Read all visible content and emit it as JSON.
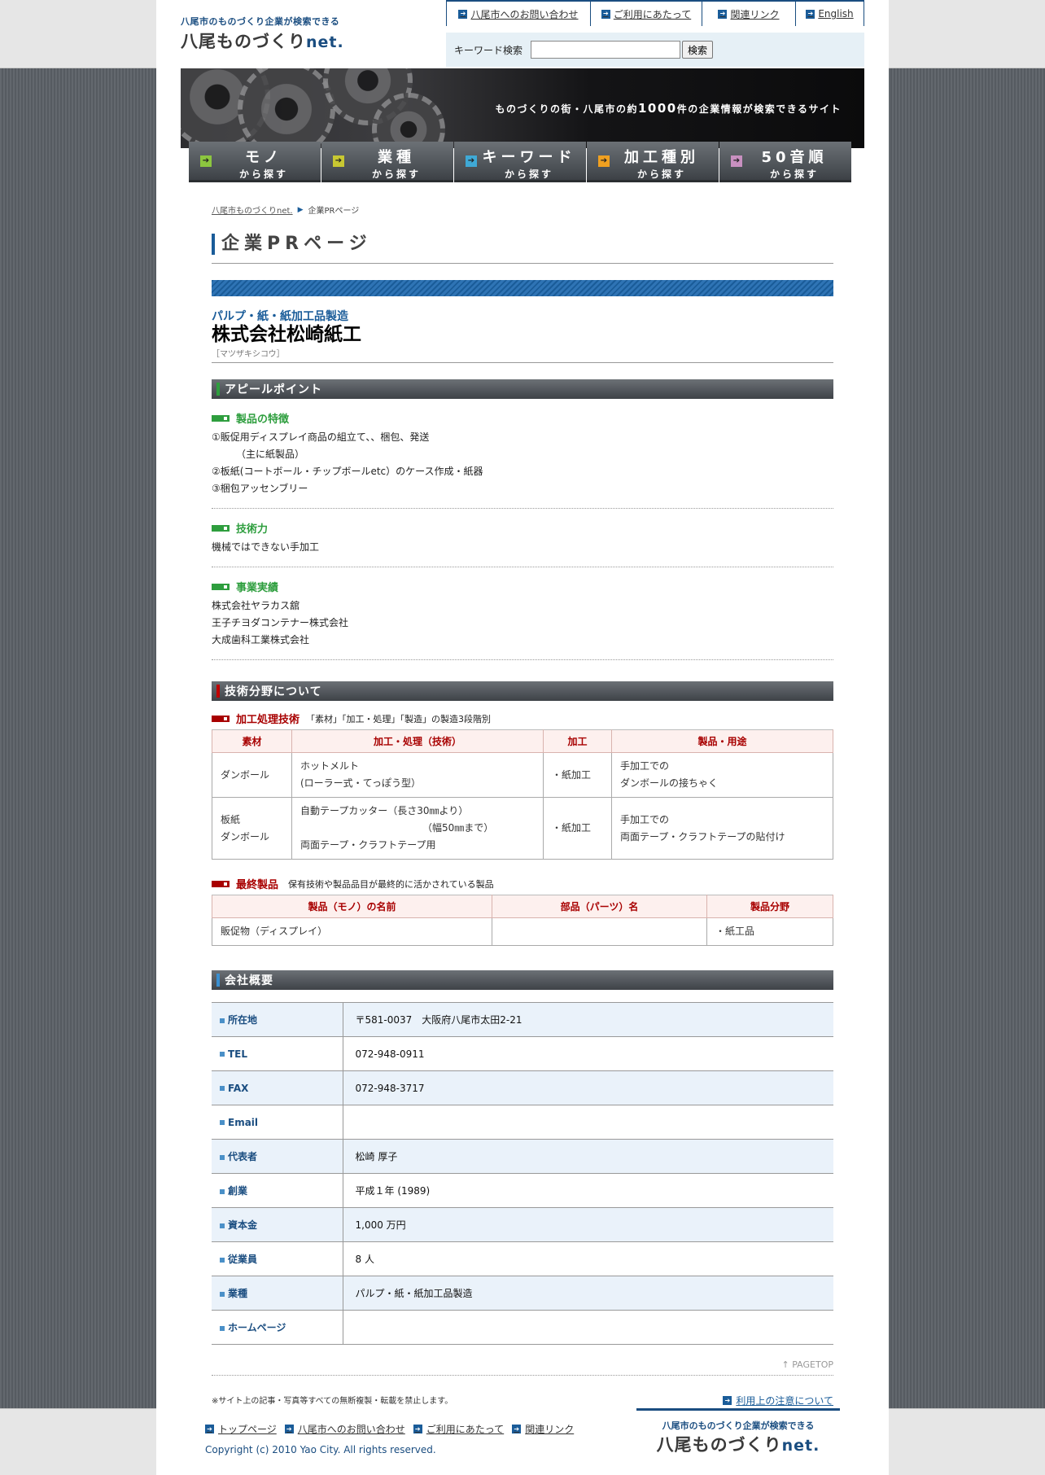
{
  "header": {
    "logo_tagline": "八尾市のものづくり企業が検索できる",
    "logo_name": "八尾ものづくり",
    "logo_suffix": "net.",
    "top_links": [
      "八尾市へのお問い合わせ",
      "ご利用にあたって",
      "関連リンク",
      "English"
    ],
    "search_label": "キーワード検索",
    "search_value": "",
    "search_button": "検索"
  },
  "banner": {
    "slogan_pre": "ものづくりの街・八尾市の約",
    "slogan_num": "1000",
    "slogan_post": "件の企業情報が検索できるサイト"
  },
  "nav": [
    {
      "big": "モノ",
      "small": "から探す",
      "icon_color": "#8cc63f"
    },
    {
      "big": "業種",
      "small": "から探す",
      "icon_color": "#c8c832"
    },
    {
      "big": "キーワード",
      "small": "から探す",
      "icon_color": "#3fa9d6"
    },
    {
      "big": "加工種別",
      "small": "から探す",
      "icon_color": "#f0a020"
    },
    {
      "big": "50音順",
      "small": "から探す",
      "icon_color": "#c890c0"
    }
  ],
  "breadcrumb": {
    "home": "八尾市ものづくりnet.",
    "current": "企業PRページ"
  },
  "page_title": "企業PRページ",
  "company": {
    "category": "パルプ・紙・紙加工品製造",
    "name": "株式会社松崎紙工",
    "kana": "［マツザキシコウ］"
  },
  "appeal": {
    "heading": "アピールポイント",
    "features": {
      "title": "製品の特徴",
      "lines": [
        "①販促用ディスプレイ商品の組立て、、梱包、発送",
        "（主に紙製品）",
        "②板紙(コートボール・チップボールetc）のケース作成・紙器",
        "③梱包アッセンブリー"
      ]
    },
    "tech": {
      "title": "技術力",
      "lines": [
        "機械ではできない手加工"
      ]
    },
    "record": {
      "title": "事業実績",
      "lines": [
        "株式会社ヤラカス舘",
        "王子チヨダコンテナー株式会社",
        "大成歯科工業株式会社"
      ]
    }
  },
  "tech_field": {
    "heading": "技術分野について",
    "processing": {
      "title": "加工処理技術",
      "note": "「素材」「加工・処理」「製造」の製造3段階別",
      "headers": [
        "素材",
        "加工・処理（技術）",
        "加工",
        "製品・用途"
      ],
      "rows": [
        {
          "material": [
            "ダンボール"
          ],
          "process": [
            "ホットメルト",
            "(ローラー式・てっぽう型）"
          ],
          "kako": "・紙加工",
          "use": [
            "手加工での",
            "ダンボールの接ちゃく"
          ]
        },
        {
          "material": [
            "板紙",
            "ダンボール"
          ],
          "process": [
            "自動テープカッター（長さ30㎜より）",
            "（幅50㎜まで）",
            "両面テープ・クラフトテープ用"
          ],
          "kako": "・紙加工",
          "use": [
            "手加工での",
            "両面テープ・クラフトテープの貼付け"
          ]
        }
      ]
    },
    "final": {
      "title": "最終製品",
      "note": "保有技術や製品品目が最終的に活かされている製品",
      "headers": [
        "製品（モノ）の名前",
        "部品（パーツ）名",
        "製品分野"
      ],
      "row": [
        "販促物（ディスプレイ）",
        "",
        "・紙工品"
      ]
    }
  },
  "overview": {
    "heading": "会社概要",
    "rows": [
      {
        "key": "所在地",
        "value": "〒581-0037　大阪府八尾市太田2-21"
      },
      {
        "key": "TEL",
        "value": "072-948-0911"
      },
      {
        "key": "FAX",
        "value": "072-948-3717"
      },
      {
        "key": "Email",
        "value": ""
      },
      {
        "key": "代表者",
        "value": "松崎 厚子"
      },
      {
        "key": "創業",
        "value": "平成１年 (1989)"
      },
      {
        "key": "資本金",
        "value": "1,000 万円"
      },
      {
        "key": "従業員",
        "value": "8 人"
      },
      {
        "key": "業種",
        "value": "パルプ・紙・紙加工品製造"
      },
      {
        "key": "ホームページ",
        "value": ""
      }
    ]
  },
  "pagetop": "PAGETOP",
  "notice": "※サイト上の記事・写真等すべての無断複製・転載を禁止します。",
  "notice_link": "利用上の注意について",
  "footer": {
    "links": [
      "トップページ",
      "八尾市へのお問い合わせ",
      "ご利用にあたって",
      "関連リンク"
    ],
    "copyright": "Copyright (c) 2010 Yao City. All rights reserved.",
    "logo_tagline": "八尾市のものづくり企業が検索できる",
    "logo_name": "八尾ものづくり",
    "logo_suffix": "net."
  },
  "colors": {
    "accent": "#1a5c99",
    "green": "#2e9e3e",
    "red": "#a80000"
  }
}
